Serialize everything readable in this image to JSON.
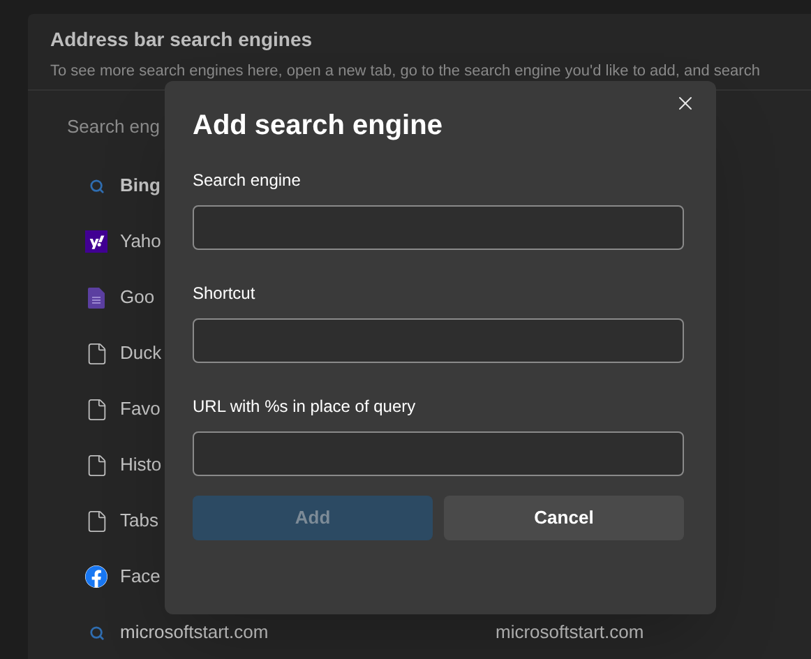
{
  "section": {
    "title": "Address bar search engines",
    "description": "To see more search engines here, open a new tab, go to the search engine you'd like to add, and search"
  },
  "search": {
    "placeholder": "Search eng"
  },
  "engines": [
    {
      "name": "Bing",
      "kind": "search",
      "bold": true
    },
    {
      "name": "Yaho",
      "kind": "yahoo",
      "bold": false
    },
    {
      "name": "Goo",
      "kind": "docs",
      "bold": false
    },
    {
      "name": "Duck",
      "kind": "file",
      "bold": false
    },
    {
      "name": "Favo",
      "kind": "file",
      "bold": false
    },
    {
      "name": "Histo",
      "kind": "file",
      "bold": false
    },
    {
      "name": "Tabs",
      "kind": "file",
      "bold": false
    },
    {
      "name": "Face",
      "kind": "facebook",
      "bold": false
    },
    {
      "name": "microsoftstart.com",
      "kind": "search",
      "bold": false,
      "keyword": "microsoftstart.com"
    }
  ],
  "dialog": {
    "title": "Add search engine",
    "fields": [
      {
        "label": "Search engine"
      },
      {
        "label": "Shortcut"
      },
      {
        "label": "URL with %s in place of query"
      }
    ],
    "buttons": [
      {
        "label": "Add",
        "kind": "primary",
        "disabled": true
      },
      {
        "label": "Cancel",
        "kind": "secondary",
        "disabled": false
      }
    ]
  }
}
